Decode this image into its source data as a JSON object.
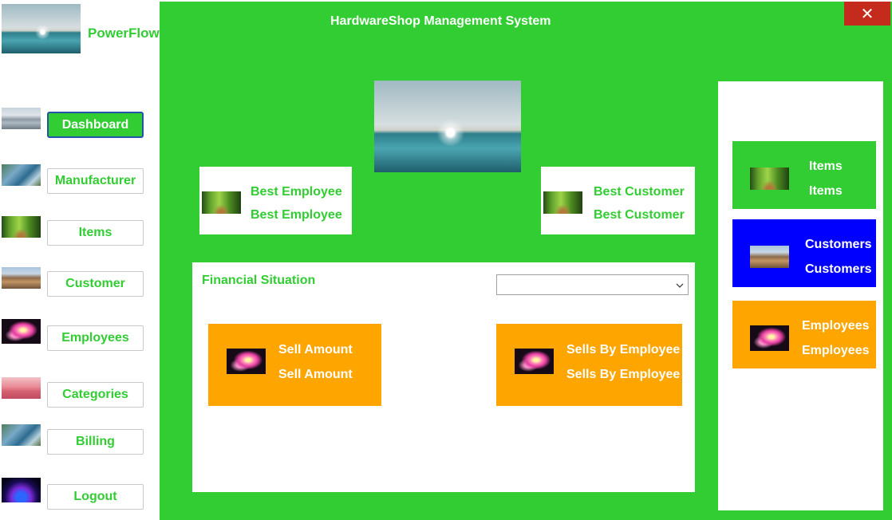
{
  "app": {
    "title": "HardwareShop Management System",
    "logo_text": "PowerFlow",
    "close_glyph": "✕"
  },
  "colors": {
    "main_green": "#32cd32",
    "orange": "#ffa500",
    "blue": "#0000ff",
    "close_red": "#c42b1c"
  },
  "sidebar": {
    "items": [
      {
        "label": "Dashboard",
        "icon": "mountain-icon",
        "active": true
      },
      {
        "label": "Manufacturer",
        "icon": "coast-icon"
      },
      {
        "label": "Items",
        "icon": "forest-icon"
      },
      {
        "label": "Customer",
        "icon": "canyon-icon"
      },
      {
        "label": "Employees",
        "icon": "flower-icon"
      },
      {
        "label": "Categories",
        "icon": "pink-hill-icon"
      },
      {
        "label": "Billing",
        "icon": "coast-icon"
      },
      {
        "label": "Logout",
        "icon": "orb-icon"
      }
    ]
  },
  "dashboard": {
    "best_employee": {
      "title": "Best Employee",
      "value": "Best Employee"
    },
    "best_customer": {
      "title": "Best Customer",
      "value": "Best Customer"
    },
    "financial": {
      "title": "Financial Situation",
      "dropdown_value": "",
      "sell_amount": {
        "title": "Sell Amount",
        "value": "Sell Amount"
      },
      "sells_by_employee": {
        "title": "Sells By Employee",
        "value": "Sells By Employee"
      }
    }
  },
  "right_panel": {
    "items": {
      "title": "Items",
      "value": "Items"
    },
    "customers": {
      "title": "Customers",
      "value": "Customers"
    },
    "employees": {
      "title": "Employees",
      "value": "Employees"
    }
  }
}
